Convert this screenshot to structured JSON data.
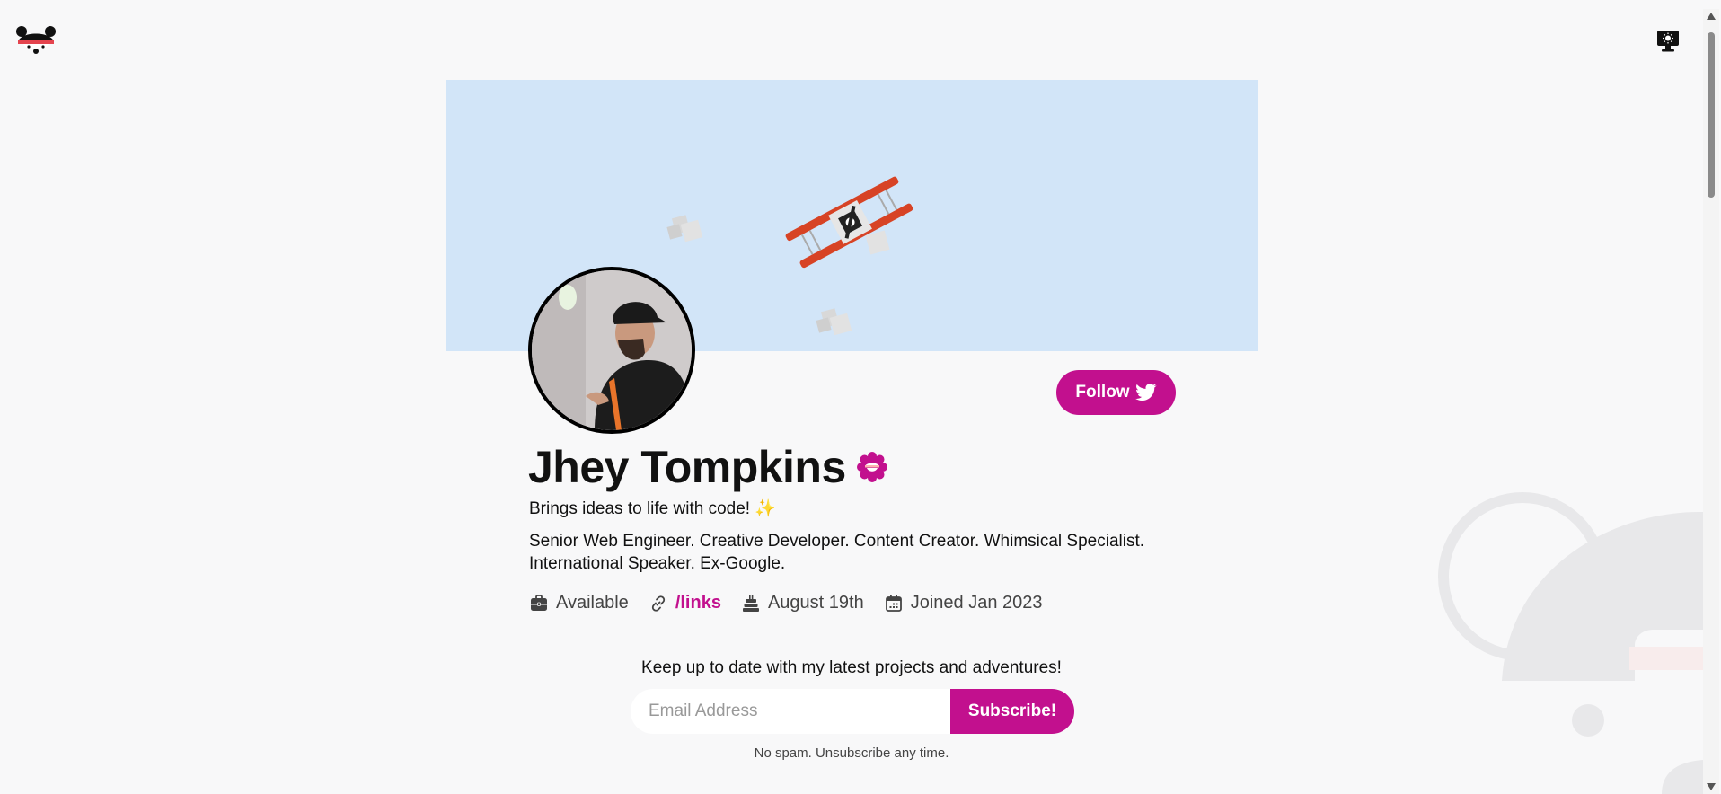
{
  "profile": {
    "name": "Jhey Tompkins",
    "tagline": "Brings ideas to life with code! ✨",
    "bio": "Senior Web Engineer. Creative Developer. Content Creator. Whimsical Specialist. International Speaker. Ex-Google.",
    "follow_label": "Follow"
  },
  "meta": {
    "status": "Available",
    "link": "/links",
    "birthday": "August 19th",
    "joined": "Joined Jan 2023"
  },
  "newsletter": {
    "heading": "Keep up to date with my latest projects and adventures!",
    "email_placeholder": "Email Address",
    "subscribe_label": "Subscribe!",
    "note": "No spam. Unsubscribe any time."
  },
  "colors": {
    "accent": "#c2108e",
    "banner": "#d2e5f8",
    "page_background": "#f8f8f9"
  },
  "icons": [
    "bear-logo-icon",
    "theme-toggle-icon",
    "twitter-icon",
    "verified-badge-icon",
    "briefcase-icon",
    "link-icon",
    "cake-icon",
    "calendar-icon"
  ]
}
